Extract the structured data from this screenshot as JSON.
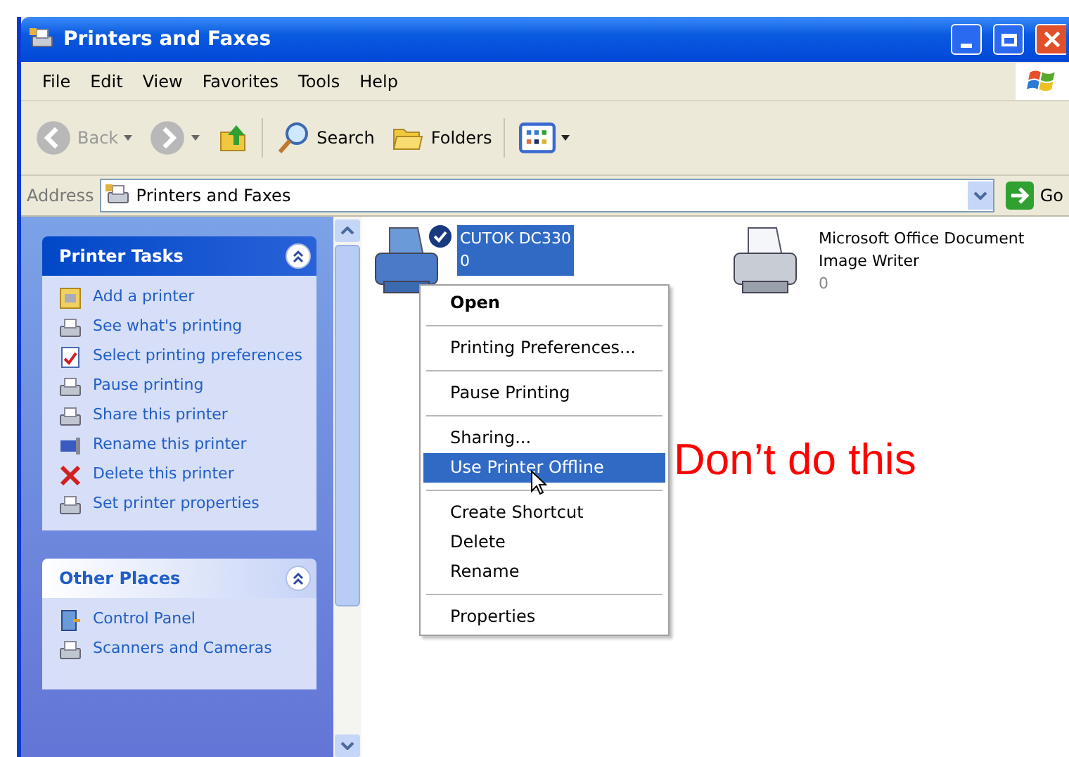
{
  "window": {
    "title": "Printers and Faxes"
  },
  "menu": [
    "File",
    "Edit",
    "View",
    "Favorites",
    "Tools",
    "Help"
  ],
  "toolbar": [
    {
      "kind": "back",
      "label": "Back",
      "disabled": true
    },
    {
      "kind": "forward",
      "disabled": true
    },
    {
      "kind": "up"
    },
    {
      "kind": "search",
      "label": "Search"
    },
    {
      "kind": "folders",
      "label": "Folders"
    },
    {
      "kind": "views"
    }
  ],
  "address": {
    "label": "Address",
    "value": "Printers and Faxes",
    "go": "Go"
  },
  "panels": [
    {
      "title": "Printer Tasks",
      "kind": "tasks",
      "items": [
        "Add a printer",
        "See what's printing",
        "Select printing preferences",
        "Pause printing",
        "Share this printer",
        "Rename this printer",
        "Delete this printer",
        "Set printer properties"
      ]
    },
    {
      "title": "Other Places",
      "kind": "places",
      "items": [
        "Control Panel",
        "Scanners and Cameras"
      ]
    }
  ],
  "printers": [
    {
      "name": "CUTOK DC330",
      "count": "0",
      "selected": true,
      "default": true
    },
    {
      "name": "Microsoft Office Document Image Writer",
      "count": "0",
      "selected": false,
      "default": false
    }
  ],
  "context_menu": [
    {
      "kind": "item",
      "label": "Open",
      "bold": true,
      "selected": false
    },
    {
      "kind": "separator"
    },
    {
      "kind": "item",
      "label": "Printing Preferences...",
      "bold": false,
      "selected": false
    },
    {
      "kind": "separator"
    },
    {
      "kind": "item",
      "label": "Pause Printing",
      "bold": false,
      "selected": false
    },
    {
      "kind": "separator"
    },
    {
      "kind": "item",
      "label": "Sharing...",
      "bold": false,
      "selected": false
    },
    {
      "kind": "item",
      "label": "Use Printer Offline",
      "bold": false,
      "selected": true
    },
    {
      "kind": "separator"
    },
    {
      "kind": "item",
      "label": "Create Shortcut",
      "bold": false,
      "selected": false
    },
    {
      "kind": "item",
      "label": "Delete",
      "bold": false,
      "selected": false
    },
    {
      "kind": "item",
      "label": "Rename",
      "bold": false,
      "selected": false
    },
    {
      "kind": "separator"
    },
    {
      "kind": "item",
      "label": "Properties",
      "bold": false,
      "selected": false
    }
  ],
  "annotation": "Don’t do this"
}
